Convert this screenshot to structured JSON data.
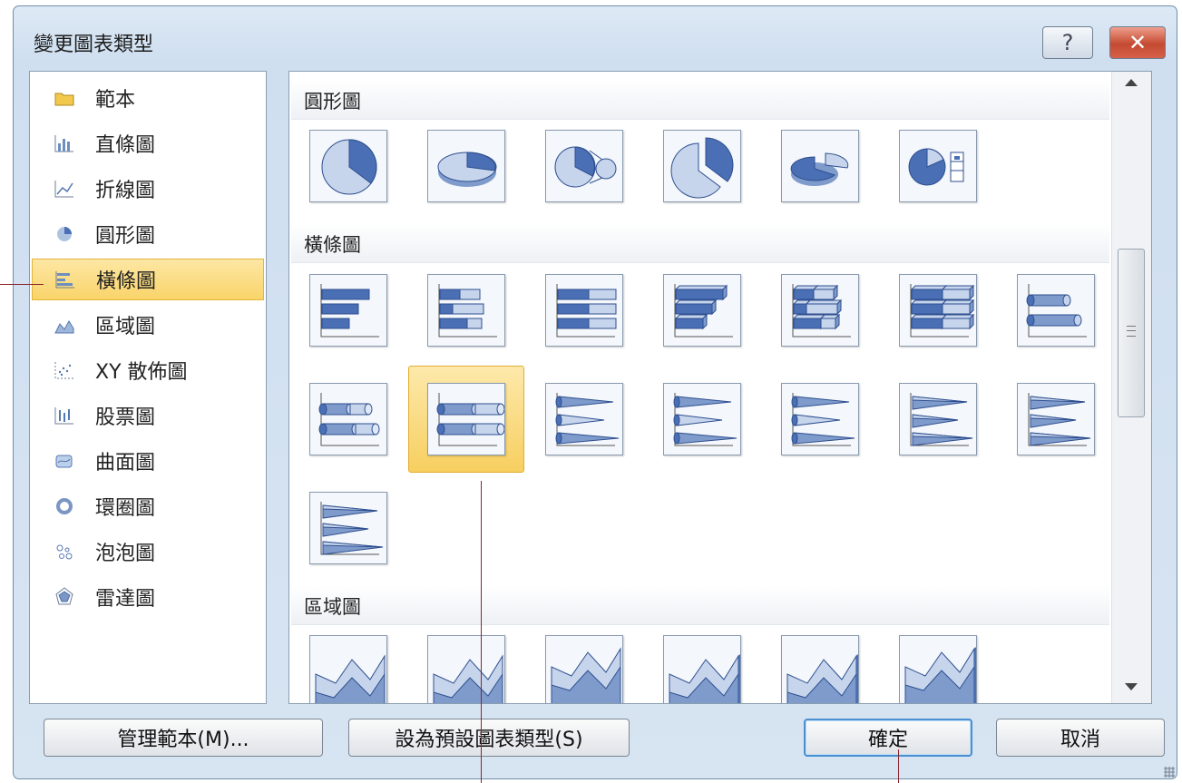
{
  "dialog": {
    "title": "變更圖表類型",
    "help_label": "?",
    "close_label": "✕"
  },
  "categories": [
    {
      "label": "範本",
      "icon": "folder-icon"
    },
    {
      "label": "直條圖",
      "icon": "column-chart-icon"
    },
    {
      "label": "折線圖",
      "icon": "line-chart-icon"
    },
    {
      "label": "圓形圖",
      "icon": "pie-chart-icon"
    },
    {
      "label": "橫條圖",
      "icon": "bar-chart-icon",
      "selected": true
    },
    {
      "label": "區域圖",
      "icon": "area-chart-icon"
    },
    {
      "label": "XY 散佈圖",
      "icon": "scatter-chart-icon"
    },
    {
      "label": "股票圖",
      "icon": "stock-chart-icon"
    },
    {
      "label": "曲面圖",
      "icon": "surface-chart-icon"
    },
    {
      "label": "環圈圖",
      "icon": "doughnut-chart-icon"
    },
    {
      "label": "泡泡圖",
      "icon": "bubble-chart-icon"
    },
    {
      "label": "雷達圖",
      "icon": "radar-chart-icon"
    }
  ],
  "sections": [
    {
      "title": "圓形圖",
      "thumbnails": [
        "pie",
        "pie-3d",
        "pie-of-pie",
        "exploded-pie",
        "exploded-pie-3d",
        "bar-of-pie"
      ]
    },
    {
      "title": "橫條圖",
      "thumbnails": [
        "clustered-bar",
        "stacked-bar",
        "100-stacked-bar",
        "clustered-bar-3d",
        "stacked-bar-3d",
        "100-stacked-bar-3d",
        "clustered-cylinder",
        "stacked-cylinder",
        "100-stacked-cylinder",
        "clustered-cone",
        "stacked-cone",
        "100-stacked-cone",
        "clustered-pyramid",
        "stacked-pyramid",
        "100-stacked-pyramid"
      ],
      "selected": "100-stacked-cylinder"
    },
    {
      "title": "區域圖",
      "thumbnails": [
        "area",
        "stacked-area",
        "100-stacked-area",
        "area-3d",
        "stacked-area-3d",
        "100-stacked-area-3d"
      ]
    }
  ],
  "buttons": {
    "manage_templates": "管理範本(M)...",
    "set_default": "設為預設圖表類型(S)",
    "ok": "確定",
    "cancel": "取消"
  },
  "colors": {
    "accent": "#f9d46a",
    "chart_blue": "#4a6fb5",
    "callout": "#8b2630"
  }
}
